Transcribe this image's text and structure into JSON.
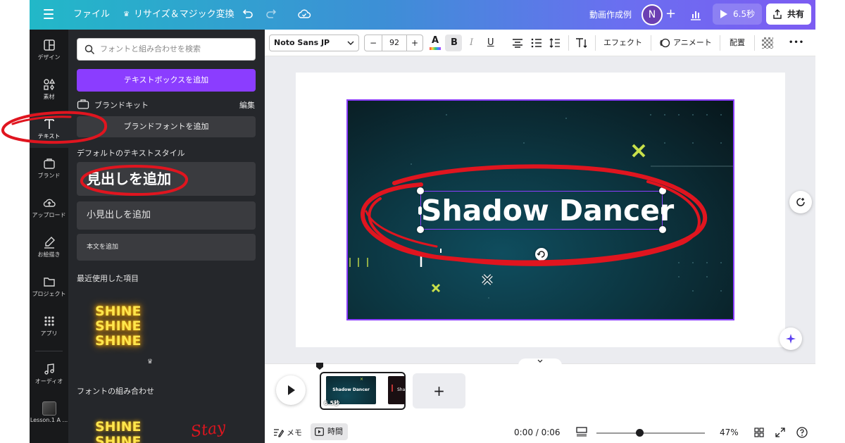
{
  "topbar": {
    "file_menu": "ファイル",
    "resize_magic": "リサイズ＆マジック変換",
    "project_title": "動画作成例",
    "avatar_initial": "N",
    "play_duration": "6.5秒",
    "share_label": "共有"
  },
  "rail": {
    "items": [
      {
        "label": "デザイン",
        "icon": "layout-icon"
      },
      {
        "label": "素材",
        "icon": "elements-icon"
      },
      {
        "label": "テキスト",
        "icon": "text-icon"
      },
      {
        "label": "ブランド",
        "icon": "brand-icon"
      },
      {
        "label": "アップロード",
        "icon": "upload-icon"
      },
      {
        "label": "お絵描き",
        "icon": "draw-icon"
      },
      {
        "label": "プロジェクト",
        "icon": "folder-icon"
      },
      {
        "label": "アプリ",
        "icon": "apps-icon"
      },
      {
        "label": "オーディオ",
        "icon": "music-icon"
      },
      {
        "label": "Lesson.1 A ..."
      }
    ]
  },
  "panel": {
    "search_placeholder": "フォントと組み合わせを検索",
    "add_textbox": "テキストボックスを追加",
    "brand_kit": "ブランドキット",
    "edit": "編集",
    "add_brand_font": "ブランドフォントを追加",
    "default_styles": "デフォルトのテキストスタイル",
    "add_heading": "見出しを追加",
    "add_subheading": "小見出しを追加",
    "add_body": "本文を追加",
    "recent_items": "最近使用した項目",
    "shine_text": "SHINE",
    "font_combos": "フォントの組み合わせ",
    "stay_text": "Stay"
  },
  "toolbar": {
    "font_name": "Noto Sans JP",
    "minus": "−",
    "font_size": "92",
    "plus": "+",
    "effect": "エフェクト",
    "animate": "アニメート",
    "position": "配置",
    "more": "•••"
  },
  "canvas": {
    "heading_text": "Shadow Dancer"
  },
  "timeline": {
    "clip_title": "Shadow Dancer",
    "clip_title_2": "Sha",
    "clip_duration": "6.5秒",
    "add_page": "+",
    "memo": "メモ",
    "time": "時間",
    "playback_time": "0:00 / 0:06",
    "zoom": "47%"
  },
  "colors": {
    "accent_purple": "#8b3dff",
    "annotation_red": "#e0151f",
    "neon_yellow": "#ffe64d",
    "cross_lime": "#c8e04a"
  }
}
